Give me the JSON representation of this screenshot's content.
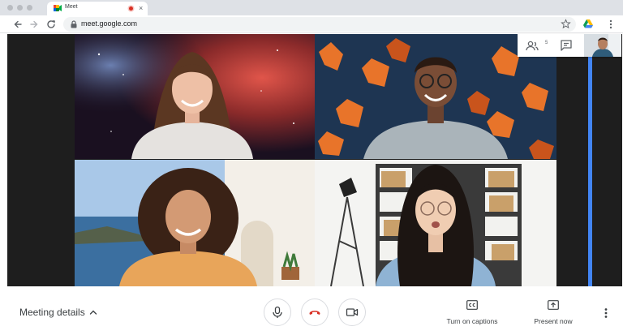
{
  "browser": {
    "tab": {
      "title": "Meet",
      "close_glyph": "×"
    },
    "url": "meet.google.com"
  },
  "meeting": {
    "participant_count": "5",
    "details_label": "Meeting details",
    "captions_label": "Turn on captions",
    "present_label": "Present now"
  },
  "colors": {
    "accent_blue": "#4285f4",
    "hangup_red": "#d93025",
    "icon_gray": "#5f6368"
  },
  "icons": [
    "back-icon",
    "forward-icon",
    "reload-icon",
    "lock-icon",
    "star-icon",
    "drive-icon",
    "kebab-menu-icon",
    "people-icon",
    "chat-icon",
    "mic-icon",
    "hangup-icon",
    "camera-icon",
    "captions-icon",
    "present-icon"
  ]
}
